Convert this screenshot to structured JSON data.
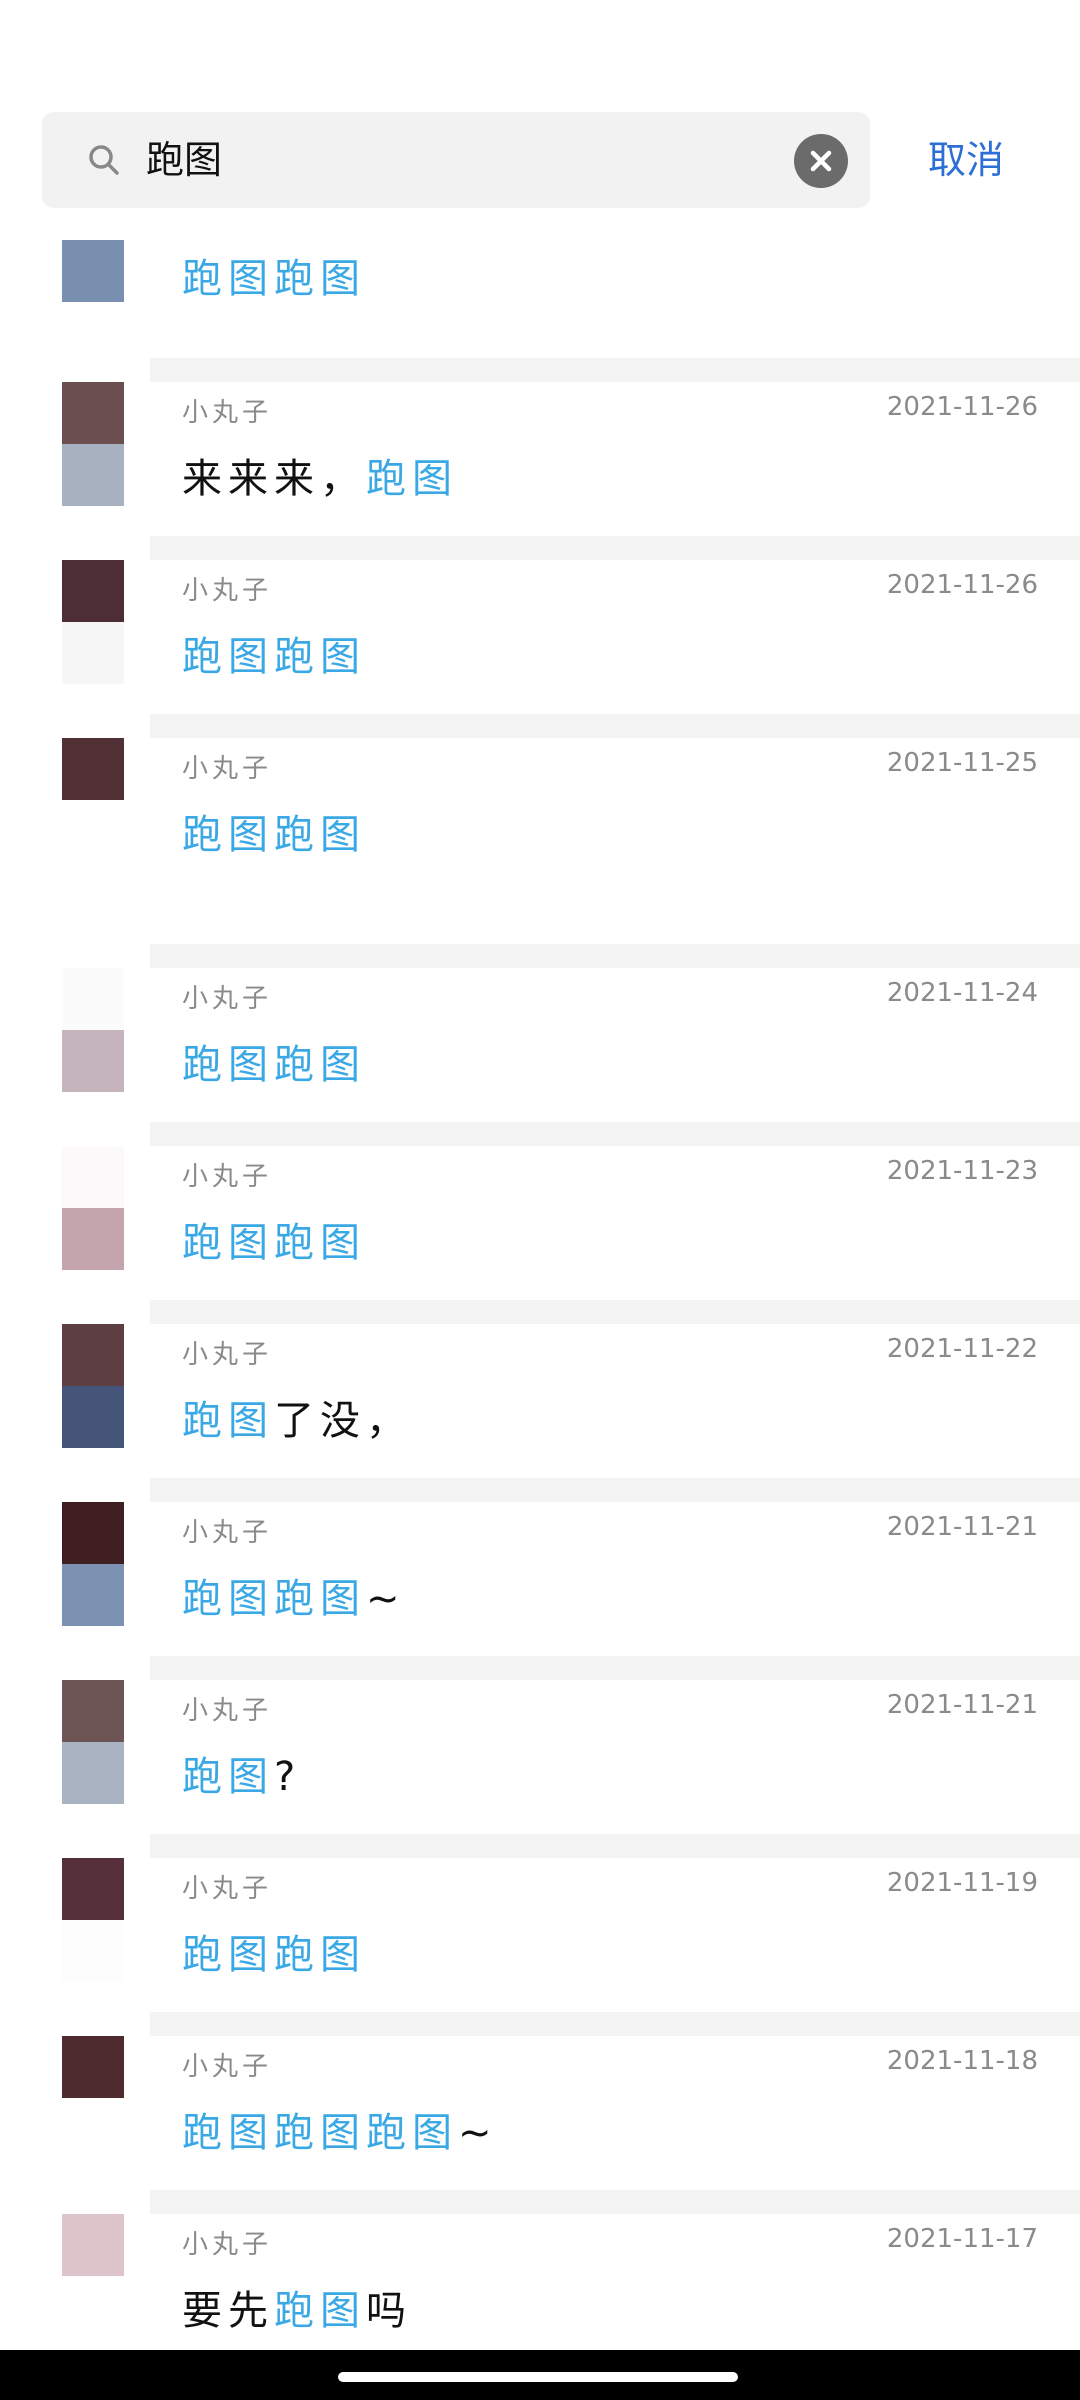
{
  "search": {
    "query": "跑图",
    "cancel_label": "取消"
  },
  "results": [
    {
      "name": "",
      "date": "",
      "segments": [
        {
          "text": "跑图跑图",
          "hl": true
        }
      ],
      "avatar": [
        "#7a90b0",
        "#ffffff"
      ]
    },
    {
      "name": "小丸子",
      "date": "2021-11-26",
      "segments": [
        {
          "text": "来来来，",
          "hl": false
        },
        {
          "text": "跑图",
          "hl": true
        }
      ],
      "avatar": [
        "#6a4e50",
        "#a7b1c0"
      ]
    },
    {
      "name": "小丸子",
      "date": "2021-11-26",
      "segments": [
        {
          "text": "跑图跑图",
          "hl": true
        }
      ],
      "avatar": [
        "#4e2e35",
        "#f7f7f8"
      ]
    },
    {
      "name": "小丸子",
      "date": "2021-11-25",
      "segments": [
        {
          "text": "跑图跑图",
          "hl": true
        }
      ],
      "avatar": [
        "#513036",
        "#ffffff"
      ]
    },
    {
      "name": "小丸子",
      "date": "2021-11-24",
      "segments": [
        {
          "text": "跑图跑图",
          "hl": true
        }
      ],
      "avatar": [
        "#fbfbfc",
        "#c5b4bb"
      ]
    },
    {
      "name": "小丸子",
      "date": "2021-11-23",
      "segments": [
        {
          "text": "跑图跑图",
          "hl": true
        }
      ],
      "avatar": [
        "#fcf9fa",
        "#c4a4ad"
      ]
    },
    {
      "name": "小丸子",
      "date": "2021-11-22",
      "segments": [
        {
          "text": "跑图",
          "hl": true
        },
        {
          "text": "了没，",
          "hl": false
        }
      ],
      "avatar": [
        "#5c3e43",
        "#45557a"
      ]
    },
    {
      "name": "小丸子",
      "date": "2021-11-21",
      "segments": [
        {
          "text": "跑图跑图",
          "hl": true
        },
        {
          "text": "~",
          "hl": false
        }
      ],
      "avatar": [
        "#3f1f22",
        "#7c92b2"
      ]
    },
    {
      "name": "小丸子",
      "date": "2021-11-21",
      "segments": [
        {
          "text": "跑图",
          "hl": true
        },
        {
          "text": "?",
          "hl": false
        }
      ],
      "avatar": [
        "#6d5556",
        "#a9b3c1"
      ]
    },
    {
      "name": "小丸子",
      "date": "2021-11-19",
      "segments": [
        {
          "text": "跑图跑图",
          "hl": true
        }
      ],
      "avatar": [
        "#55303a",
        "#fdfdfd"
      ]
    },
    {
      "name": "小丸子",
      "date": "2021-11-18",
      "segments": [
        {
          "text": "跑图跑图跑图",
          "hl": true
        },
        {
          "text": "~",
          "hl": false
        }
      ],
      "avatar": [
        "#4e2b2f",
        "#ffffff"
      ]
    },
    {
      "name": "小丸子",
      "date": "2021-11-17",
      "segments": [
        {
          "text": "要先",
          "hl": false
        },
        {
          "text": "跑图",
          "hl": true
        },
        {
          "text": "吗",
          "hl": false
        }
      ],
      "avatar": [
        "#dcc4ca",
        "#ffffff"
      ]
    }
  ],
  "colors": {
    "highlight": "#3aa8e4",
    "cancel": "#2e6fd6",
    "separator": "#f4f4f4"
  },
  "icons": {
    "search": "search-icon",
    "clear": "close-circle-icon"
  }
}
